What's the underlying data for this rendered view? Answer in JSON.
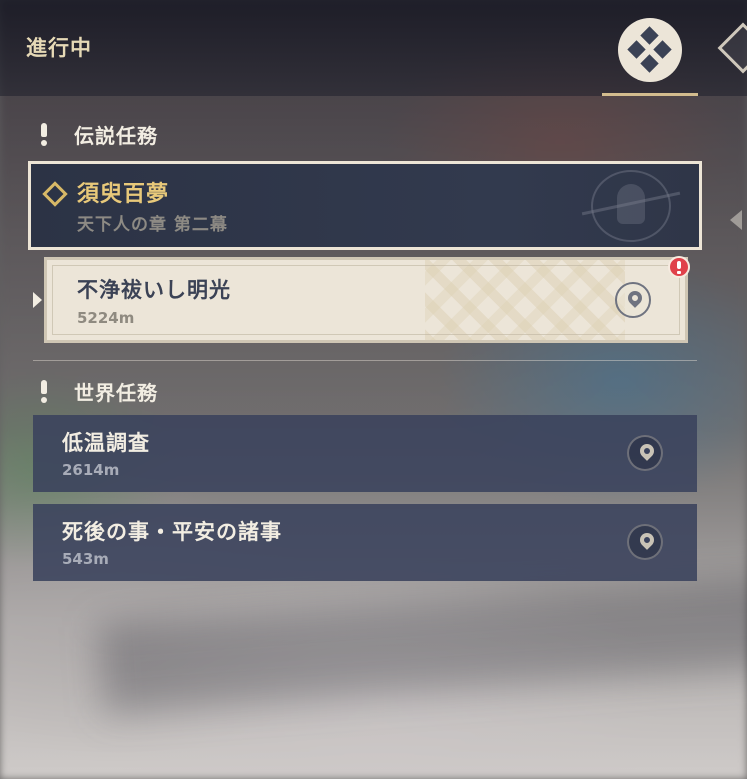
{
  "header": {
    "title": "進行中",
    "active_tab_icon": "quest-category-icon",
    "next_tab_icon": "quest-type-icon"
  },
  "sections": {
    "legend": {
      "title": "伝説任務",
      "quest": {
        "title": "須臾百夢",
        "subtitle": "天下人の章 第二幕",
        "objective": {
          "title": "不浄祓いし明光",
          "distance": "5224m"
        }
      }
    },
    "world": {
      "title": "世界任務",
      "quests": [
        {
          "title": "低温調査",
          "distance": "2614m"
        },
        {
          "title": "死後の事・平安の諸事",
          "distance": "543m"
        }
      ]
    }
  },
  "colors": {
    "accent_gold": "#d3bc8e",
    "legend_title": "#e8c97a",
    "card_light": "#ece5d8",
    "card_dark": "#3a425c",
    "alert": "#e0414a"
  }
}
